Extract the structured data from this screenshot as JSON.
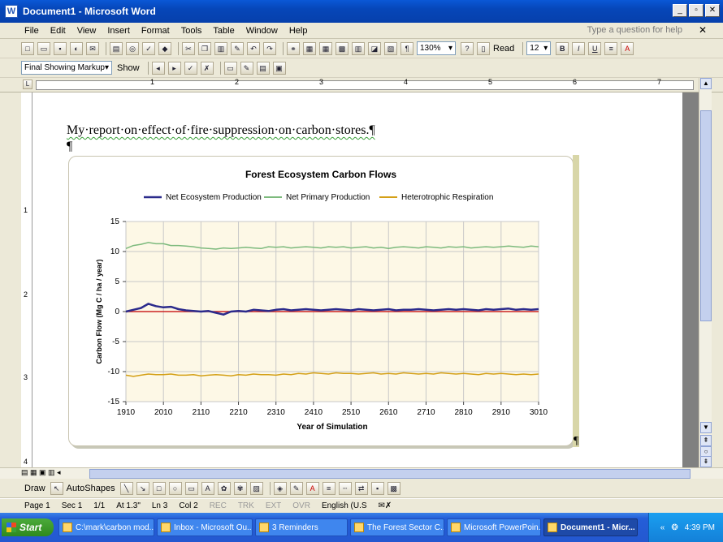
{
  "window": {
    "title": "Document1 - Microsoft Word",
    "controls": [
      "_",
      "▫",
      "✕"
    ]
  },
  "menu": {
    "items": [
      "File",
      "Edit",
      "View",
      "Insert",
      "Format",
      "Tools",
      "Table",
      "Window",
      "Help"
    ],
    "help_placeholder": "Type a question for help",
    "close_doc": "✕"
  },
  "standard_toolbar": {
    "zoom": "130%",
    "read_label": "Read",
    "font_size": "12",
    "bold": "B",
    "italic": "I",
    "underline": "U",
    "font_color": "A"
  },
  "review_toolbar": {
    "markup_mode": "Final Showing Markup",
    "show_label": "Show"
  },
  "ruler": {
    "numbers": [
      "1",
      "2",
      "3",
      "4",
      "5",
      "6",
      "7"
    ]
  },
  "vertical_ruler": {
    "numbers": [
      "1",
      "2",
      "3",
      "4"
    ]
  },
  "document": {
    "heading": "My·report·on·effect·of·fire·suppression·on·carbon·stores.¶",
    "empty_paragraph": "¶",
    "anchor_mark": "¶"
  },
  "chart_data": {
    "type": "line",
    "title": "Forest Ecosystem Carbon Flows",
    "xlabel": "Year of Simulation",
    "ylabel": "Carbon Flow (Mg C / ha / year)",
    "xlim": [
      1910,
      3010
    ],
    "ylim": [
      -15,
      15
    ],
    "x_ticks": [
      "1910",
      "2010",
      "2110",
      "2210",
      "2310",
      "2410",
      "2510",
      "2610",
      "2710",
      "2810",
      "2910",
      "3010"
    ],
    "y_ticks": [
      "15",
      "10",
      "5",
      "0",
      "-5",
      "-10",
      "-15"
    ],
    "grid": true,
    "legend": "top",
    "plot_background": "#fdf8e6",
    "zero_line_color": "#cc2222",
    "x": [
      1910,
      1930,
      1950,
      1970,
      1990,
      2010,
      2030,
      2050,
      2070,
      2090,
      2110,
      2130,
      2150,
      2170,
      2190,
      2210,
      2230,
      2250,
      2270,
      2290,
      2310,
      2330,
      2350,
      2370,
      2390,
      2410,
      2430,
      2450,
      2470,
      2490,
      2510,
      2530,
      2550,
      2570,
      2590,
      2610,
      2630,
      2650,
      2670,
      2690,
      2710,
      2730,
      2750,
      2770,
      2790,
      2810,
      2830,
      2850,
      2870,
      2890,
      2910,
      2930,
      2950,
      2970,
      2990,
      3010
    ],
    "series": [
      {
        "name": "Net Ecosystem Production",
        "color": "#2b2b8c",
        "width": 2.5,
        "values": [
          0.0,
          0.3,
          0.6,
          1.3,
          0.9,
          0.7,
          0.8,
          0.4,
          0.2,
          0.1,
          0.0,
          0.1,
          -0.2,
          -0.5,
          0.0,
          0.1,
          0.0,
          0.3,
          0.2,
          0.1,
          0.3,
          0.4,
          0.2,
          0.3,
          0.4,
          0.3,
          0.2,
          0.3,
          0.4,
          0.3,
          0.2,
          0.4,
          0.3,
          0.2,
          0.3,
          0.4,
          0.2,
          0.3,
          0.3,
          0.4,
          0.3,
          0.2,
          0.3,
          0.4,
          0.3,
          0.4,
          0.3,
          0.2,
          0.4,
          0.3,
          0.4,
          0.5,
          0.3,
          0.4,
          0.3,
          0.4
        ]
      },
      {
        "name": "Net Primary Production",
        "color": "#7dba7d",
        "width": 1.5,
        "values": [
          10.5,
          11.0,
          11.2,
          11.5,
          11.3,
          11.3,
          11.0,
          11.0,
          10.9,
          10.8,
          10.6,
          10.5,
          10.4,
          10.6,
          10.5,
          10.6,
          10.7,
          10.6,
          10.5,
          10.8,
          10.7,
          10.8,
          10.6,
          10.7,
          10.8,
          10.7,
          10.6,
          10.8,
          10.7,
          10.8,
          10.6,
          10.7,
          10.8,
          10.6,
          10.7,
          10.5,
          10.7,
          10.8,
          10.7,
          10.6,
          10.8,
          10.7,
          10.6,
          10.8,
          10.7,
          10.8,
          10.6,
          10.7,
          10.8,
          10.7,
          10.8,
          10.9,
          10.8,
          10.7,
          10.9,
          10.8
        ]
      },
      {
        "name": "Heterotrophic Respiration",
        "color": "#d4a017",
        "width": 1.5,
        "values": [
          -10.6,
          -10.8,
          -10.6,
          -10.4,
          -10.5,
          -10.5,
          -10.4,
          -10.6,
          -10.6,
          -10.5,
          -10.7,
          -10.6,
          -10.5,
          -10.6,
          -10.7,
          -10.5,
          -10.6,
          -10.4,
          -10.5,
          -10.5,
          -10.6,
          -10.4,
          -10.5,
          -10.3,
          -10.4,
          -10.2,
          -10.3,
          -10.4,
          -10.2,
          -10.3,
          -10.3,
          -10.4,
          -10.3,
          -10.2,
          -10.4,
          -10.3,
          -10.4,
          -10.2,
          -10.3,
          -10.4,
          -10.3,
          -10.4,
          -10.2,
          -10.3,
          -10.4,
          -10.3,
          -10.4,
          -10.5,
          -10.3,
          -10.4,
          -10.3,
          -10.4,
          -10.5,
          -10.4,
          -10.5,
          -10.4
        ]
      }
    ]
  },
  "draw_toolbar": {
    "draw_label": "Draw",
    "autoshapes_label": "AutoShapes"
  },
  "status": {
    "page": "Page 1",
    "sec": "Sec 1",
    "pages": "1/1",
    "at": "At 1.3\"",
    "ln": "Ln 3",
    "col": "Col 2",
    "rec": "REC",
    "trk": "TRK",
    "ext": "EXT",
    "ovr": "OVR",
    "language": "English (U.S"
  },
  "taskbar": {
    "start_label": "Start",
    "tasks": [
      "C:\\mark\\carbon mod...",
      "Inbox - Microsoft Ou...",
      "3 Reminders",
      "The Forest Sector C...",
      "Microsoft PowerPoin...",
      "Document1 - Micr..."
    ],
    "clock": "4:39 PM"
  }
}
